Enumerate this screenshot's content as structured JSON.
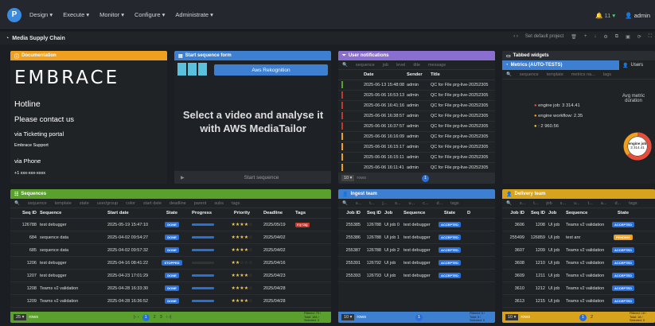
{
  "app": {
    "logo": "P",
    "menu": [
      "Design ▾",
      "Execute ▾",
      "Monitor ▾",
      "Configure ▾",
      "Administrate ▾"
    ],
    "notifications": "11 ▾",
    "user": "admin"
  },
  "page": {
    "title": "Media Supply Chain",
    "default_project": "Set default project"
  },
  "doc": {
    "title": "Documentation",
    "brand": "EMBRACE",
    "hotline": "Hotline",
    "contact": "Please contact us",
    "ticketing": "via Ticketing portal",
    "support": "Embrace Support",
    "phone_label": "via Phone",
    "phone": "+1 xxx-xxx-xxxx"
  },
  "seqform": {
    "title": "Start sequence form",
    "select_label": "Aws Rekognition",
    "message": "Select a video and analyse it with AWS MediaTailor",
    "start": "Start sequence"
  },
  "notif": {
    "title": "User notifications",
    "filters": [
      "sequence",
      "job",
      "level",
      "title",
      "message"
    ],
    "cols": [
      "Date",
      "Sender",
      "Title"
    ],
    "rows": [
      [
        "2025-06-13 15:48:08",
        "admin",
        "QC for File prg-live-20252305"
      ],
      [
        "2025-06-06 16:53:13",
        "admin",
        "QC for File prg-live-20252305"
      ],
      [
        "2025-06-06 16:41:16",
        "admin",
        "QC for File prg-live-20252305"
      ],
      [
        "2025-06-06 16:38:57",
        "admin",
        "QC for File prg-live-20252305"
      ],
      [
        "2025-06-06 16:37:57",
        "admin",
        "QC for File prg-live-20252305"
      ],
      [
        "2025-06-06 16:16:09",
        "admin",
        "QC for File prg-live-20252305"
      ],
      [
        "2025-06-06 16:15:17",
        "admin",
        "QC for File prg-live-20252305"
      ],
      [
        "2025-06-06 16:15:11",
        "admin",
        "QC for File prg-live-20252305"
      ],
      [
        "2025-06-06 16:11:41",
        "admin",
        "QC for File prg-live-20252305"
      ]
    ],
    "rows_label": "rows"
  },
  "tabbed": {
    "title": "Tabbed widgets",
    "tab1": "Metrics (AUTO-TESTS)",
    "tab2": "Users",
    "filters": [
      "sequence",
      "template",
      "metrics na...",
      "tags"
    ],
    "legend": [
      "engine job: 3 314.41",
      "engine workflow: 2.35",
      ": 2 960.56"
    ],
    "avg_title": "Avg metric duration",
    "donut_label": "engine job",
    "donut_value": "3 314.41"
  },
  "sequences": {
    "title": "Sequences",
    "filters": [
      "sequence",
      "template",
      "state",
      "user/group",
      "color",
      "start date",
      "deadline",
      "parent",
      "subs",
      "tags"
    ],
    "cols": [
      "Seq ID",
      "Sequence",
      "Start date",
      "State",
      "Progress",
      "Priority",
      "Deadline",
      "Tags"
    ],
    "rows": [
      {
        "id": "126788",
        "name": "test debugger",
        "date": "2025-05-19 15:47:10",
        "state": "DONE",
        "progress": 1,
        "stars": 4,
        "deadline": "2025/05/19",
        "tag": "my tag"
      },
      {
        "id": "684",
        "name": "sequence data",
        "date": "2025-04-02 09:54:27",
        "state": "DONE",
        "progress": 1,
        "stars": 4,
        "deadline": "2025/04/02",
        "tag": ""
      },
      {
        "id": "685",
        "name": "sequence data",
        "date": "2025-04-02 09:57:32",
        "state": "DONE",
        "progress": 1,
        "stars": 4,
        "deadline": "2025/04/02",
        "tag": ""
      },
      {
        "id": "1206",
        "name": "test debugger",
        "date": "2025-04-16 08:41:22",
        "state": "STOPPED",
        "progress": 0,
        "stars": 2,
        "deadline": "2025/04/16",
        "tag": ""
      },
      {
        "id": "1207",
        "name": "test debugger",
        "date": "2025-04-23 17:01:29",
        "state": "DONE",
        "progress": 1,
        "stars": 4,
        "deadline": "2025/04/23",
        "tag": ""
      },
      {
        "id": "1208",
        "name": "Teams v2 validation",
        "date": "2025-04-28 16:33:30",
        "state": "DONE",
        "progress": 1,
        "stars": 4,
        "deadline": "2025/04/28",
        "tag": ""
      },
      {
        "id": "1209",
        "name": "Teams v2 validation",
        "date": "2025-04-28 16:36:52",
        "state": "DONE",
        "progress": 1,
        "stars": 4,
        "deadline": "2025/04/28",
        "tag": ""
      }
    ],
    "rows_select": "25 ▾",
    "rows_label": "rows",
    "pages": [
      "1",
      "2",
      "3"
    ],
    "stats": "Filtered: 79 / Total: 184 / Selected: 0"
  },
  "ingest": {
    "title": "Ingest team",
    "filters": [
      "s...",
      "t...",
      "j...",
      "s...",
      "u...",
      "c...",
      "d...",
      "tags"
    ],
    "cols": [
      "Job ID",
      "Seq ID",
      "Job",
      "Sequence",
      "State",
      "D"
    ],
    "rows": [
      [
        "255385",
        "126788",
        "UI job 0",
        "test debugger",
        "ACCEPTED"
      ],
      [
        "255386",
        "126788",
        "UI job 1",
        "test debugger",
        "ACCEPTED"
      ],
      [
        "255387",
        "126788",
        "UI job 2",
        "test debugger",
        "ACCEPTED"
      ],
      [
        "255391",
        "126792",
        "UI job",
        "test debugger",
        "ACCEPTED"
      ],
      [
        "255393",
        "126793",
        "UI job",
        "test debugger",
        "ACCEPTED"
      ]
    ],
    "rows_select": "10 ▾",
    "rows_label": "rows",
    "pages": [
      "1"
    ],
    "stats": "Filtered: 5 / Total: 5 / Selected: 0"
  },
  "delivery": {
    "title": "Delivery team",
    "filters": [
      "s...",
      "t...",
      "job",
      "s...",
      "u...",
      "t...",
      "a...",
      "d...",
      "tags"
    ],
    "cols": [
      "Job ID",
      "Seq ID",
      "Job",
      "Sequence",
      "State"
    ],
    "rows": [
      [
        "3606",
        "1208",
        "UI job",
        "Teams v2 validation",
        "ACCEPTED"
      ],
      [
        "255499",
        "126859",
        "UI job",
        "test anr",
        "PENDING"
      ],
      [
        "3607",
        "1209",
        "UI job",
        "Teams v2 validation",
        "ACCEPTED"
      ],
      [
        "3608",
        "1210",
        "UI job",
        "Teams v2 validation",
        "ACCEPTED"
      ],
      [
        "3609",
        "1211",
        "UI job",
        "Teams v2 validation",
        "ACCEPTED"
      ],
      [
        "3610",
        "1212",
        "UI job",
        "Teams v2 validation",
        "ACCEPTED"
      ],
      [
        "3613",
        "1215",
        "UI job",
        "Teams v2 validation",
        "ACCEPTED"
      ]
    ],
    "rows_select": "10 ▾",
    "rows_label": "rows",
    "pages": [
      "1",
      "2"
    ],
    "stats": "Filtered: 18 / Total: 18 / Selected: 0"
  },
  "colors": {
    "orange": "#f0a020",
    "blue": "#3d7fd1",
    "purple": "#8a6fd1",
    "green": "#5aa02c",
    "yellow": "#d7a31c",
    "accent": "#2a6fd6"
  }
}
